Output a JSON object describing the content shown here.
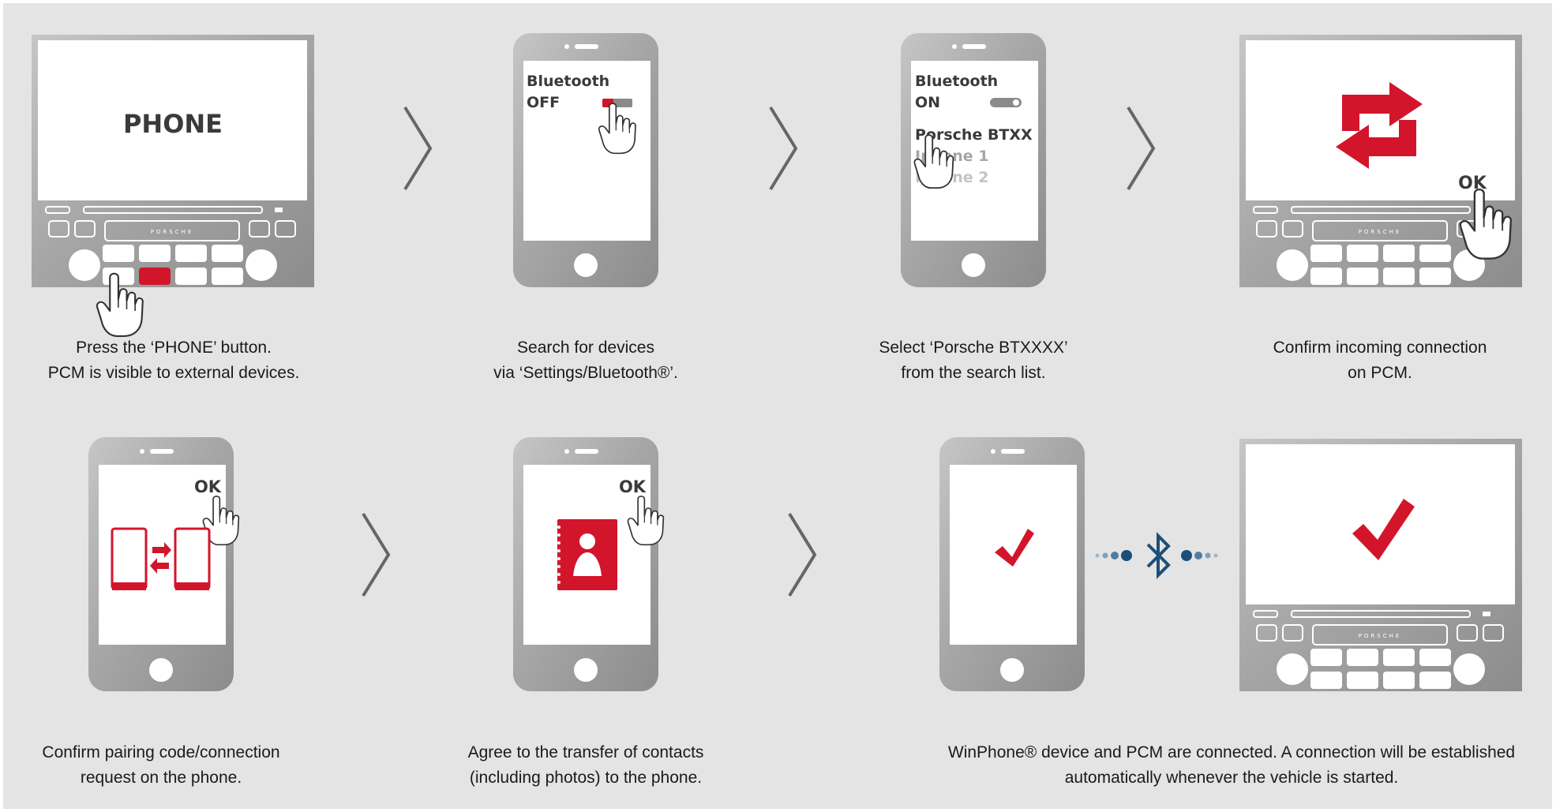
{
  "steps": {
    "s1": {
      "screen_label": "PHONE",
      "caption_line1": "Press the ‘PHONE’ button.",
      "caption_line2": "PCM is visible to external devices."
    },
    "s2": {
      "screen_line1": "Bluetooth",
      "screen_line2": "OFF",
      "caption_line1": "Search for devices",
      "caption_line2": "via ‘Settings/Bluetooth®’."
    },
    "s3": {
      "screen_line1": "Bluetooth",
      "screen_line2": "ON",
      "device1": "Porsche BTXX",
      "device2": "Iphone 1",
      "device3": "Iphone 2",
      "caption_line1": "Select ‘Porsche BTXXXX’",
      "caption_line2": "from the search list."
    },
    "s4": {
      "ok_label": "OK",
      "caption_line1": "Confirm incoming connection",
      "caption_line2": "on PCM."
    },
    "s5": {
      "ok_label": "OK",
      "caption_line1": "Confirm pairing code/connection",
      "caption_line2": "request on the phone."
    },
    "s6": {
      "ok_label": "OK",
      "caption_line1": "Agree to the transfer of contacts",
      "caption_line2": "(including photos) to the phone."
    },
    "s7": {
      "caption_line1": "WinPhone® device and PCM are connected. A connection will be established",
      "caption_line2": "automatically whenever the vehicle is started."
    }
  },
  "pcm_brand": "PORSCHE",
  "colors": {
    "accent": "#d3152b",
    "bluetooth": "#1b4f7a",
    "text": "#1a1a1a",
    "background": "#e4e4e4"
  },
  "icons": [
    "finger-press-icon",
    "swap-arrows-icon",
    "phone-transfer-icon",
    "contacts-book-icon",
    "checkmark-icon",
    "bluetooth-icon",
    "chevron-right-icon"
  ]
}
